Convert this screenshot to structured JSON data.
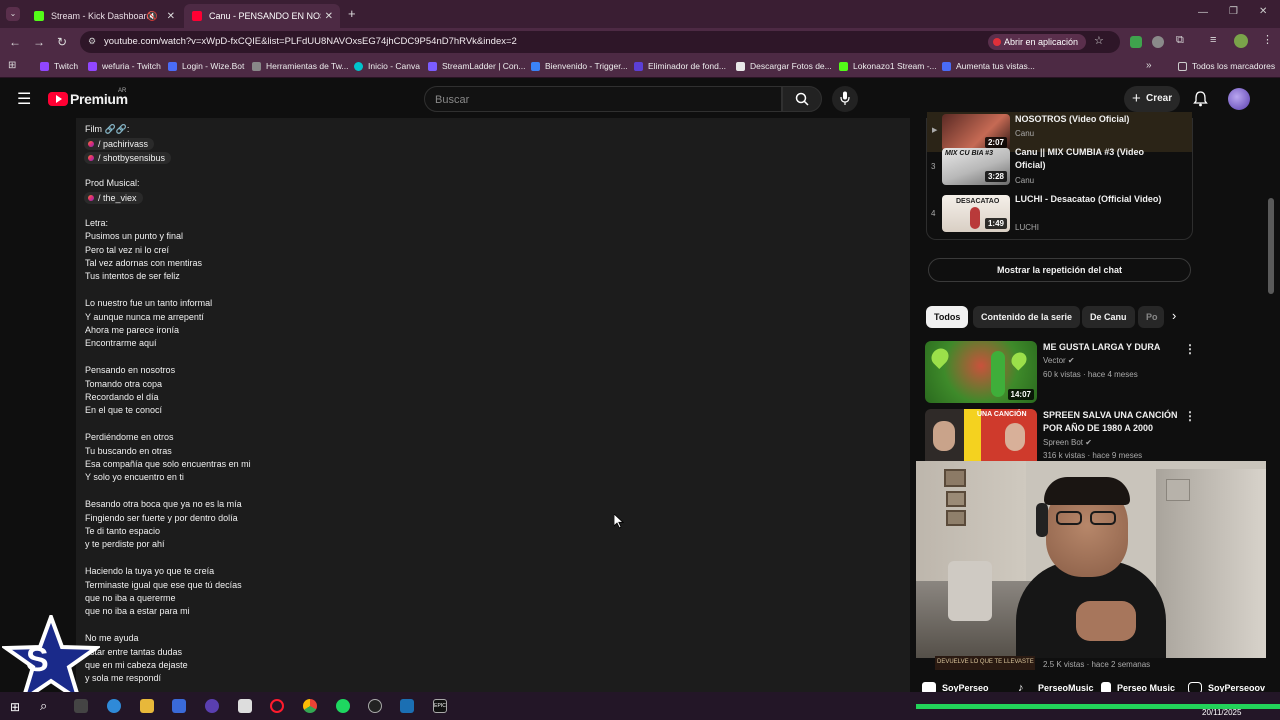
{
  "browser": {
    "tabs": [
      {
        "label": "Stream - Kick Dashboard",
        "color": "#53fc18"
      },
      {
        "label": "Canu - PENSANDO EN NOSOTR",
        "color": "#ff0033"
      }
    ],
    "url": "youtube.com/watch?v=xWpD-fxCQIE&list=PLFdUU8NAVOxsEG74jhCDC9P54nD7hRVk&index=2",
    "open_in_app": "Abrir en aplicación",
    "bookmarks": [
      {
        "label": "Twitch",
        "color": "#9146ff"
      },
      {
        "label": "wefuria - Twitch",
        "color": "#9146ff"
      },
      {
        "label": "Login - Wize.Bot",
        "color": "#4a6cf7"
      },
      {
        "label": "Herramientas de Tw...",
        "color": "#888888"
      },
      {
        "label": "Inicio - Canva",
        "color": "#00c4cc"
      },
      {
        "label": "StreamLadder | Con...",
        "color": "#7b5cff"
      },
      {
        "label": "Bienvenido - Trigger...",
        "color": "#3b82f6"
      },
      {
        "label": "Eliminador de fond...",
        "color": "#5b3fd6"
      },
      {
        "label": "Descargar Fotos de...",
        "color": "#e8e8e8"
      },
      {
        "label": "Lokonazo1 Stream -...",
        "color": "#53fc18"
      },
      {
        "label": "Aumenta tus vistas...",
        "color": "#4a6cf7"
      }
    ],
    "all_bookmarks": "Todos los marcadores"
  },
  "youtube": {
    "logo": "Premium",
    "region": "AR",
    "search_placeholder": "Buscar",
    "create_label": "Crear"
  },
  "description": {
    "lines": [
      {
        "text": "Film 🔗🔗:",
        "type": "text"
      },
      {
        "text": "/ pachirivass",
        "type": "chip"
      },
      {
        "text": "/ shotbysensibus",
        "type": "chip"
      },
      {
        "text": "",
        "type": "blank"
      },
      {
        "text": "Prod Musical:",
        "type": "text"
      },
      {
        "text": "/ the_viex",
        "type": "chip"
      },
      {
        "text": "",
        "type": "blank"
      },
      {
        "text": "Letra:",
        "type": "text"
      },
      {
        "text": "Pusimos un punto y final",
        "type": "text"
      },
      {
        "text": "Pero tal vez ni lo creí",
        "type": "text"
      },
      {
        "text": "Tal vez adornas con mentiras",
        "type": "text"
      },
      {
        "text": "Tus intentos de ser feliz",
        "type": "text"
      },
      {
        "text": "",
        "type": "blank"
      },
      {
        "text": "Lo nuestro fue un tanto informal",
        "type": "text"
      },
      {
        "text": "Y aunque nunca me arrepentí",
        "type": "text"
      },
      {
        "text": "Ahora me parece ironía",
        "type": "text"
      },
      {
        "text": "Encontrarme aquí",
        "type": "text"
      },
      {
        "text": "",
        "type": "blank"
      },
      {
        "text": "Pensando en nosotros",
        "type": "text"
      },
      {
        "text": "Tomando otra copa",
        "type": "text"
      },
      {
        "text": "Recordando el día",
        "type": "text"
      },
      {
        "text": "En el que te conocí",
        "type": "text"
      },
      {
        "text": "",
        "type": "blank"
      },
      {
        "text": "Perdiéndome en otros",
        "type": "text"
      },
      {
        "text": "Tu buscando en otras",
        "type": "text"
      },
      {
        "text": "Esa compañía que solo encuentras en mi",
        "type": "text"
      },
      {
        "text": "Y solo yo encuentro en ti",
        "type": "text"
      },
      {
        "text": "",
        "type": "blank"
      },
      {
        "text": "Besando otra boca que ya no es la mía",
        "type": "text"
      },
      {
        "text": "Fingiendo ser fuerte y por dentro dolía",
        "type": "text"
      },
      {
        "text": "Te di tanto espacio",
        "type": "text"
      },
      {
        "text": "y te perdiste por ahí",
        "type": "text"
      },
      {
        "text": "",
        "type": "blank"
      },
      {
        "text": "Haciendo la tuya yo que te creía",
        "type": "text"
      },
      {
        "text": "Terminaste igual que ese que tú decías",
        "type": "text"
      },
      {
        "text": "que no iba a quererme",
        "type": "text"
      },
      {
        "text": "que no iba a estar para mi",
        "type": "text"
      },
      {
        "text": "",
        "type": "blank"
      },
      {
        "text": "No me ayuda",
        "type": "text"
      },
      {
        "text": "estar entre tantas dudas",
        "type": "text"
      },
      {
        "text": "que en mi cabeza dejaste",
        "type": "text"
      },
      {
        "text": "y sola me respondí",
        "type": "text"
      }
    ]
  },
  "playlist": [
    {
      "num": "",
      "title": "NOSOTROS (Video Oficial)",
      "channel": "Canu",
      "duration": "2:07",
      "active": true
    },
    {
      "num": "3",
      "title": "Canu || MIX CUMBIA #3 (Video Oficial)",
      "channel": "Canu",
      "duration": "3:28",
      "active": false
    },
    {
      "num": "4",
      "title": "LUCHI - Desacatao (Official Video)",
      "channel": "LUCHI",
      "duration": "1:49",
      "active": false
    }
  ],
  "replay_chat": "Mostrar la repetición del chat",
  "filter_chips": [
    "Todos",
    "Contenido de la serie",
    "De Canu",
    "Po"
  ],
  "recommendations": [
    {
      "title": "ME GUSTA LARGA Y DURA",
      "channel": "Vector ✔",
      "meta": "60 k vistas · hace 4 meses",
      "duration": "14:07"
    },
    {
      "title": "SPREEN SALVA UNA CANCIÓN POR AÑO DE 1980 A 2000",
      "channel": "Spreen Bot ✔",
      "meta": "316 k vistas · hace 9 meses",
      "duration": ""
    }
  ],
  "hidden_rec_meta": "2.5 K vistas · hace 2 semanas",
  "stream_socials": [
    {
      "label": "SoyPerseo",
      "icon": "youtube-icon"
    },
    {
      "label": "PerseoMusic",
      "icon": "tiktok-icon"
    },
    {
      "label": "Perseo Music",
      "icon": "kick-icon"
    },
    {
      "label": "SoyPerseoov",
      "icon": "instagram-icon"
    }
  ],
  "taskbar": {
    "clock_date": "20/11/2025"
  }
}
